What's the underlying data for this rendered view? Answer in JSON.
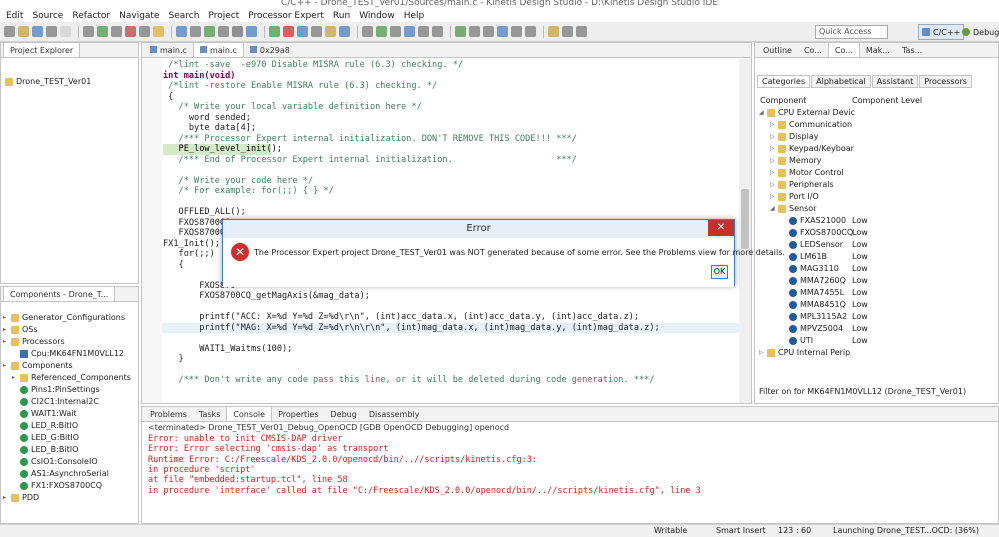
{
  "window": {
    "title": "C/C++ - Drone_TEST_Ver01/Sources/main.c - Kinetis Design Studio - D:\\Kinetis Design Studio IDE"
  },
  "menu": [
    "Edit",
    "Source",
    "Refactor",
    "Navigate",
    "Search",
    "Project",
    "Processor Expert",
    "Run",
    "Window",
    "Help"
  ],
  "toolbar": {
    "quick_access_placeholder": "Quick Access",
    "perspective_active": "C/C++",
    "perspective_other": "Debug"
  },
  "project_explorer": {
    "tab": "Project Explorer",
    "items": [
      "Drone_TEST_Ver01"
    ]
  },
  "components": {
    "tab": "Components - Drone_T...",
    "items": [
      {
        "label": "Generator_Configurations",
        "level": 0,
        "icon": "folder-icon"
      },
      {
        "label": "OSs",
        "level": 0,
        "icon": "folder-icon"
      },
      {
        "label": "Processors",
        "level": 0,
        "icon": "folder-icon"
      },
      {
        "label": "Cpu:MK64FN1M0VLL12",
        "level": 1,
        "icon": "chip-icon"
      },
      {
        "label": "Components",
        "level": 0,
        "icon": "folder-icon"
      },
      {
        "label": "Referenced_Components",
        "level": 1,
        "icon": "folder-icon"
      },
      {
        "label": "Pins1:PinSettings",
        "level": 1,
        "icon": "component-icon"
      },
      {
        "label": "CI2C1:Internal2C",
        "level": 1,
        "icon": "component-icon"
      },
      {
        "label": "WAIT1:Wait",
        "level": 1,
        "icon": "component-icon"
      },
      {
        "label": "LED_R:BitIO",
        "level": 1,
        "icon": "component-icon"
      },
      {
        "label": "LED_G:BitIO",
        "level": 1,
        "icon": "component-icon"
      },
      {
        "label": "LED_B:BitIO",
        "level": 1,
        "icon": "component-icon"
      },
      {
        "label": "CsIO1:ConsoleIO",
        "level": 1,
        "icon": "component-icon"
      },
      {
        "label": "AS1:AsynchroSerial",
        "level": 1,
        "icon": "component-icon"
      },
      {
        "label": "FX1:FXOS8700CQ",
        "level": 1,
        "icon": "component-icon"
      },
      {
        "label": "PDD",
        "level": 0,
        "icon": "folder-icon"
      }
    ]
  },
  "editor": {
    "tabs": [
      "main.c",
      "main.c",
      "0x29a8"
    ],
    "lines": [
      {
        "t": " /*lint -save  -e970 Disable MISRA rule (6.3) checking. */",
        "c": "cm"
      },
      {
        "t": "int main(void)",
        "c": "kw"
      },
      {
        "t": " /*lint -restore Enable MISRA rule (6.3) checking. */",
        "c": "cm"
      },
      {
        "t": " {",
        "c": ""
      },
      {
        "t": "   /* Write your local variable definition here */",
        "c": "cm"
      },
      {
        "t": "     word sended;",
        "c": ""
      },
      {
        "t": "     byte data[4];",
        "c": ""
      },
      {
        "t": "   /*** Processor Expert internal initialization. DON'T REMOVE THIS CODE!!! ***/",
        "c": "cm"
      },
      {
        "t": "   PE_low_level_init();",
        "c": "hl"
      },
      {
        "t": "   /*** End of Processor Expert internal initialization.                    ***/",
        "c": "cm"
      },
      {
        "t": "",
        "c": ""
      },
      {
        "t": "   /* Write your code here */",
        "c": "cm"
      },
      {
        "t": "   /* For example: for(;;) { } */",
        "c": "cm"
      },
      {
        "t": "",
        "c": ""
      },
      {
        "t": "   OFFLED_ALL();",
        "c": ""
      },
      {
        "t": "   FXOS8700CQ",
        "c": ""
      },
      {
        "t": "   FXOS8700CQ",
        "c": ""
      },
      {
        "t": "FX1_Init();",
        "c": ""
      },
      {
        "t": "   for(;;)",
        "c": ""
      },
      {
        "t": "   {",
        "c": ""
      },
      {
        "t": "",
        "c": ""
      },
      {
        "t": "       FXOS870",
        "c": ""
      },
      {
        "t": "       FXOS8700CQ_getMagAxis(&mag_data);",
        "c": ""
      },
      {
        "t": "",
        "c": ""
      },
      {
        "t": "       printf(\"ACC: X=%d Y=%d Z=%d\\r\\n\", (int)acc_data.x, (int)acc_data.y, (int)acc_data.z);",
        "c": ""
      },
      {
        "t": "       printf(\"MAG: X=%d Y=%d Z=%d\\r\\n\\r\\n\", (int)mag_data.x, (int)mag_data.y, (int)mag_data.z);",
        "c": "sel"
      },
      {
        "t": "",
        "c": ""
      },
      {
        "t": "       WAIT1_Waitms(100);",
        "c": ""
      },
      {
        "t": "   }",
        "c": ""
      },
      {
        "t": "",
        "c": ""
      },
      {
        "t": "   /*** Don't write any code pass this line, or it will be deleted during code generation. ***/",
        "c": "cm"
      }
    ]
  },
  "right_panel": {
    "tabs": [
      "Outline",
      "Co...",
      "Co...",
      "Mak...",
      "Tas..."
    ],
    "subtabs": [
      "Categories",
      "Alphabetical",
      "Assistant",
      "Processors"
    ],
    "col_component": "Component",
    "col_level": "Component Level",
    "rows": [
      {
        "label": "CPU External Devic",
        "indent": 0,
        "expand": "open",
        "level": ""
      },
      {
        "label": "Communication",
        "indent": 1,
        "expand": "closed",
        "level": ""
      },
      {
        "label": "Display",
        "indent": 1,
        "expand": "closed",
        "level": ""
      },
      {
        "label": "Keypad/Keyboar",
        "indent": 1,
        "expand": "closed",
        "level": ""
      },
      {
        "label": "Memory",
        "indent": 1,
        "expand": "closed",
        "level": ""
      },
      {
        "label": "Motor Control",
        "indent": 1,
        "expand": "closed",
        "level": ""
      },
      {
        "label": "Peripherals",
        "indent": 1,
        "expand": "closed",
        "level": ""
      },
      {
        "label": "Port I/O",
        "indent": 1,
        "expand": "closed",
        "level": ""
      },
      {
        "label": "Sensor",
        "indent": 1,
        "expand": "open",
        "level": ""
      },
      {
        "label": "FXAS21000",
        "indent": 2,
        "expand": "",
        "level": "Low"
      },
      {
        "label": "FXOS8700CQ",
        "indent": 2,
        "expand": "",
        "level": "Low"
      },
      {
        "label": "LEDSensor",
        "indent": 2,
        "expand": "",
        "level": "Low"
      },
      {
        "label": "LM61B",
        "indent": 2,
        "expand": "",
        "level": "Low"
      },
      {
        "label": "MAG3110",
        "indent": 2,
        "expand": "",
        "level": "Low"
      },
      {
        "label": "MMA7260Q",
        "indent": 2,
        "expand": "",
        "level": "Low"
      },
      {
        "label": "MMA7455L",
        "indent": 2,
        "expand": "",
        "level": "Low"
      },
      {
        "label": "MMA8451Q",
        "indent": 2,
        "expand": "",
        "level": "Low"
      },
      {
        "label": "MPL3115A2",
        "indent": 2,
        "expand": "",
        "level": "Low"
      },
      {
        "label": "MPVZ5004",
        "indent": 2,
        "expand": "",
        "level": "Low"
      },
      {
        "label": "UTI",
        "indent": 2,
        "expand": "",
        "level": "Low"
      },
      {
        "label": "CPU Internal Perip",
        "indent": 0,
        "expand": "closed",
        "level": ""
      }
    ],
    "filter": "Filter on for MK64FN1M0VLL12 (Drone_TEST_Ver01)"
  },
  "bottom": {
    "tabs": [
      "Problems",
      "Tasks",
      "Console",
      "Properties",
      "Debug",
      "Disassembly"
    ],
    "terminated": "<terminated> Drone_TEST_Ver01_Debug_OpenOCD [GDB OpenOCD Debugging] openocd",
    "lines": [
      "Error: unable to init CMSIS-DAP driver",
      "Error: Error selecting 'cmsis-dap' as transport",
      "Runtime Error: C:/Freescale/KDS_2.0.0/openocd/bin/..//scripts/kinetis.cfg:3:",
      "in procedure 'script'",
      "at file \"embedded:startup.tcl\", line 58",
      "in procedure 'interface' called at file \"C:/Freescale/KDS_2.0.0/openocd/bin/..//scripts/kinetis.cfg\", line 3"
    ]
  },
  "dialog": {
    "title": "Error",
    "message": "The Processor Expert project Drone_TEST_Ver01 was NOT generated because of some error. See the Problems view for more details.",
    "ok": "OK",
    "close": "✕"
  },
  "status": {
    "writable": "Writable",
    "insert": "Smart Insert",
    "position": "123 : 60",
    "progress": "Launching Drone_TEST...OCD: (36%)"
  }
}
